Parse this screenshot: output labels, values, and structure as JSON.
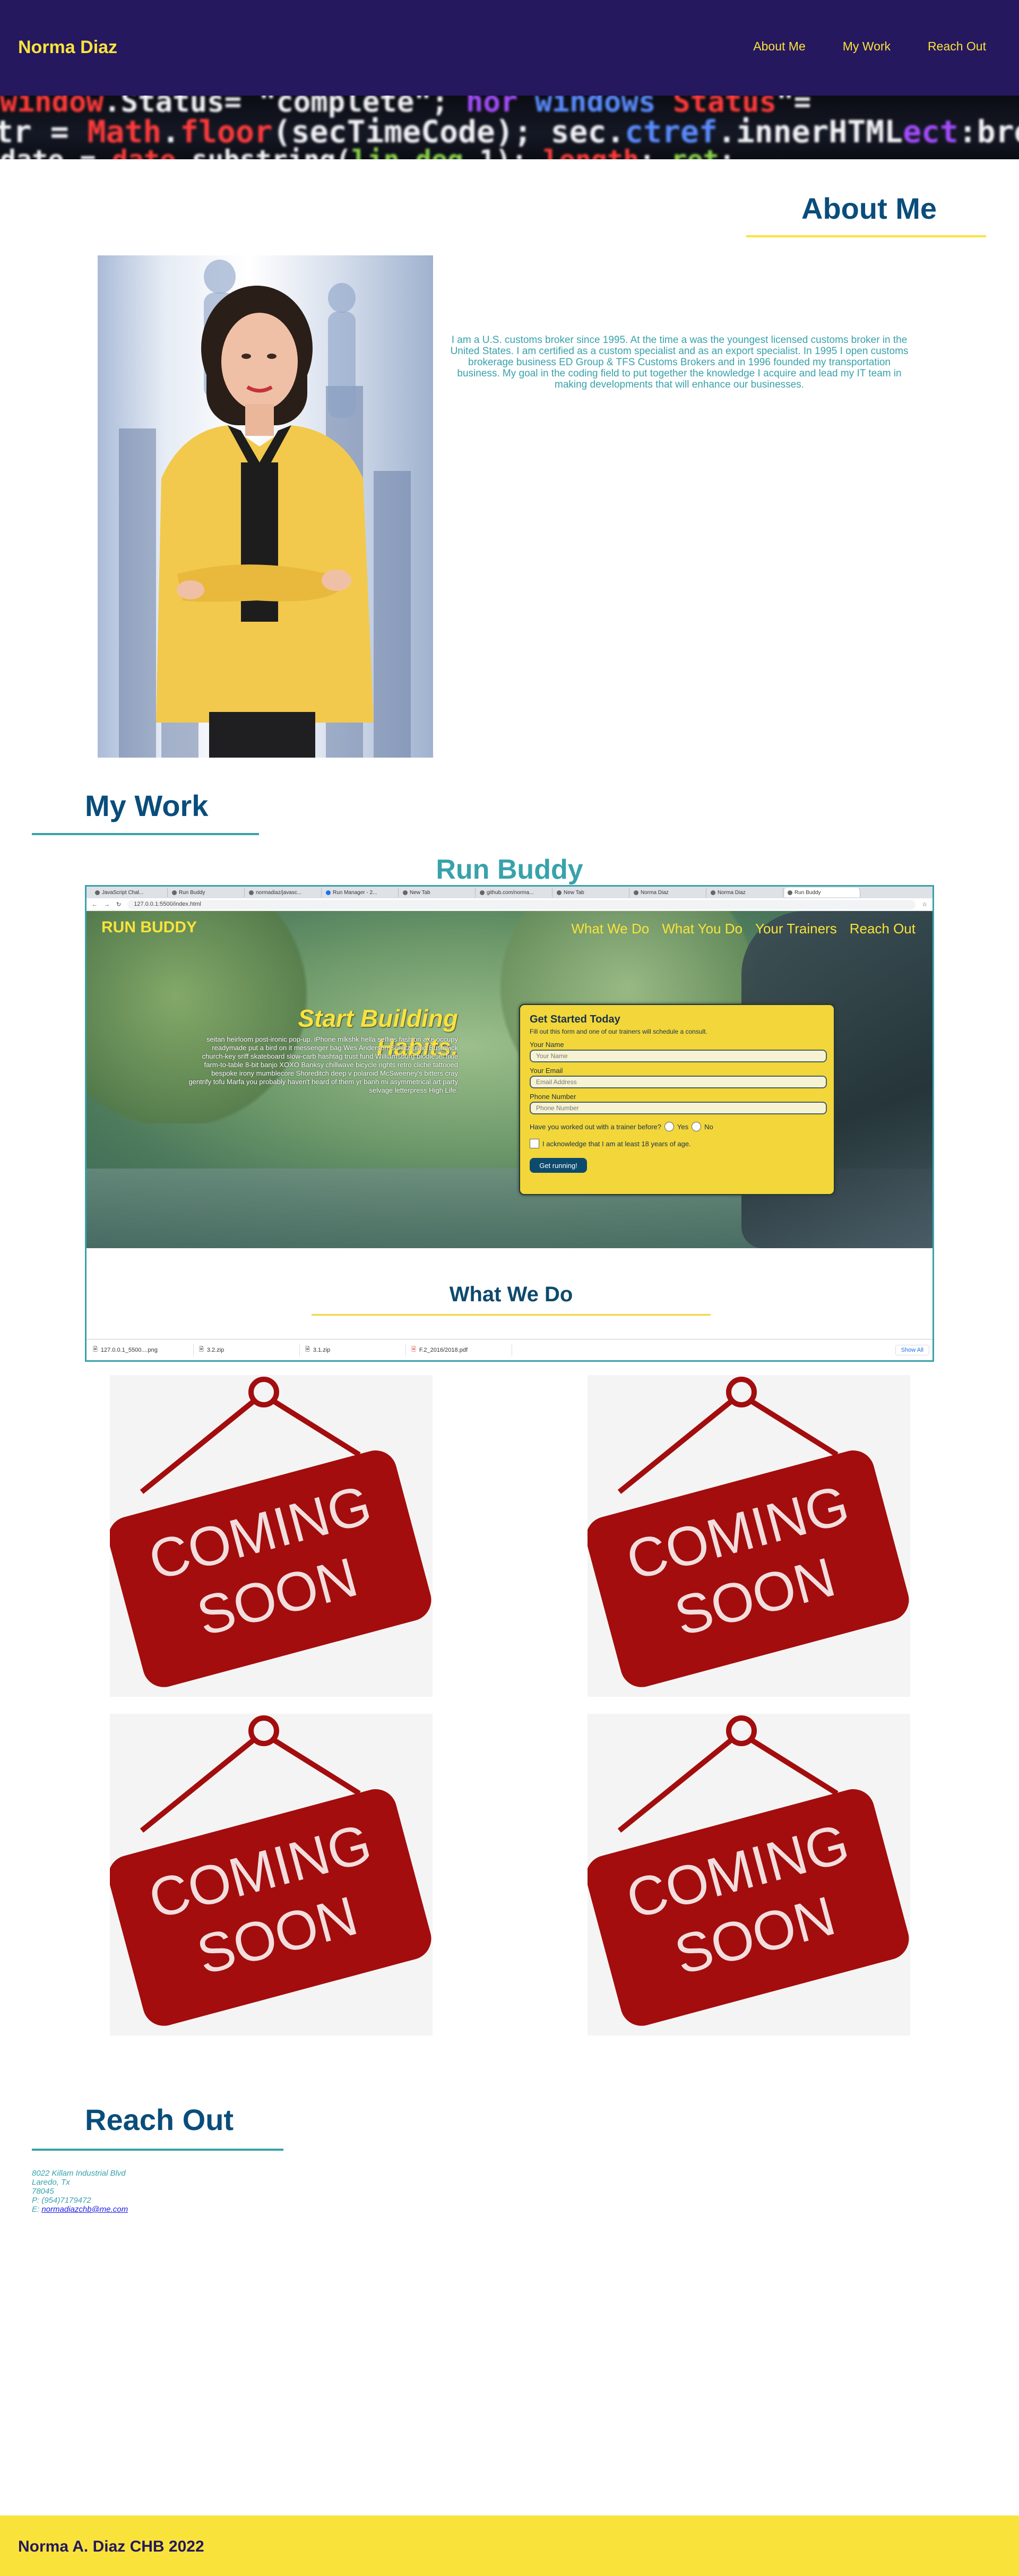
{
  "header": {
    "brand": "Norma Diaz",
    "nav": [
      "About Me",
      "My Work",
      "Reach Out"
    ],
    "colors": {
      "background": "#25185e",
      "accent": "#f9e33b"
    }
  },
  "about": {
    "heading": "About Me",
    "text": "I am a U.S. customs broker since 1995. At the time a was the youngest licensed customs broker in the United States. I am certified as a custom specialist and as an export specialist. In 1995 I open customs brokerage business ED Group & TFS Customs Brokers and in 1996 founded my transportation business. My goal in the coding field to put together the knowledge I acquire and lead my IT team in making developments that will enhance our businesses."
  },
  "work": {
    "heading": "My Work",
    "project_title": "Run Buddy",
    "browser": {
      "tabs": [
        "JavaScript Chal...",
        "Run Buddy",
        "normadiaz/javasc...",
        "Run Manager - 2...",
        "New Tab",
        "github.com/norma...",
        "New Tab",
        "Norma Diaz",
        "Norma Diaz",
        "Run Buddy"
      ],
      "url": "127.0.0.1:5500/index.html",
      "site": {
        "brand": "RUN BUDDY",
        "nav": [
          "What We Do",
          "What You Do",
          "Your Trainers",
          "Reach Out"
        ],
        "hero_heading": "Start Building Habits.",
        "hero_text": "seitan heirloom post-ironic pop-up. iPhone mlkshk hella selfies fashion axe occupy readymade put a bird on it messenger bag Wes Anderson Schlitz plaid Bushwick church-key sriff skateboard slow-carb hashtag trust fund Williamsburg biodiesel fixie farm-to-table 8-bit banjo XOXO Banksy chillwave bicycle rights retro cliche tattooed bespoke irony mumblecore Shoreditch deep v polaroid McSweeney's bitters cray gentrify tofu Marfa you probably haven't heard of them yr banh mi asymmetrical art party selvage letterpress High Life.",
        "form": {
          "title": "Get Started Today",
          "subtitle": "Fill out this form and one of our trainers will schedule a consult.",
          "name_label": "Your Name",
          "name_placeholder": "Your Name",
          "email_label": "Your Email",
          "email_placeholder": "Email Address",
          "phone_label": "Phone Number",
          "phone_placeholder": "Phone Number",
          "question": "Have you worked out with a trainer before?",
          "yes": "Yes",
          "no": "No",
          "acknowledge": "I acknowledge that I am at least 18 years of age.",
          "submit": "Get running!"
        },
        "section_heading": "What We Do"
      },
      "downloads": [
        "127.0.0.1_5500....png",
        "3.2.zip",
        "3.1.zip",
        "F.2_2016/2018.pdf"
      ],
      "show_all": "Show All"
    },
    "coming_soon": [
      "COMING",
      "SOON"
    ]
  },
  "reach": {
    "heading": "Reach Out",
    "address1": "8022 Killam Industrial Blvd",
    "address2": "Laredo, Tx",
    "zip": "78045",
    "phone": "P: (954)7179472",
    "email_prefix": "E: ",
    "email": "normadiazchb@me.com"
  },
  "footer": {
    "text": "Norma A. Diaz CHB 2022"
  }
}
